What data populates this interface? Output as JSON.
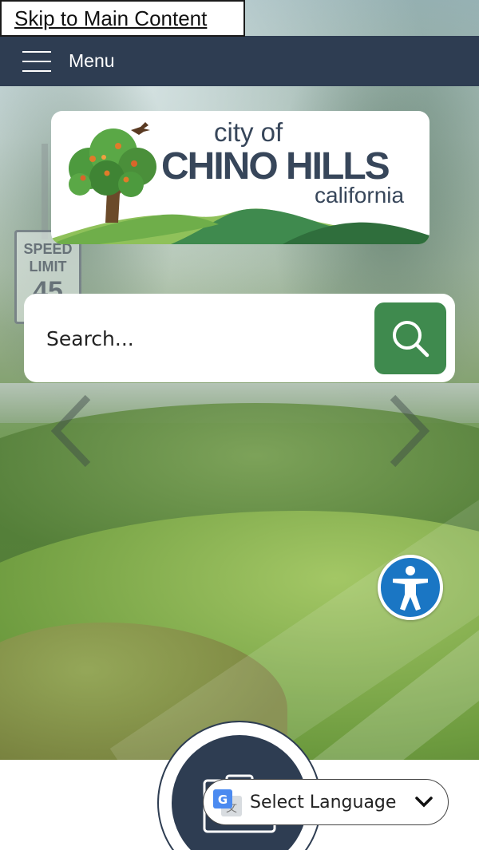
{
  "skip_link": {
    "label": "Skip to Main Content"
  },
  "menu_bar": {
    "label": "Menu",
    "icon": "hamburger-icon",
    "background": "#2e3d52"
  },
  "logo": {
    "line1": "city of",
    "line2": "CHINO HILLS",
    "line3": "california",
    "text_color": "#37465a"
  },
  "search": {
    "placeholder": "Search...",
    "button_icon": "search-icon",
    "button_color": "#3f8a4e"
  },
  "hero": {
    "prev_icon": "chevron-left-icon",
    "next_icon": "chevron-right-icon",
    "sign_line1": "SPEED",
    "sign_line2": "LIMIT",
    "sign_line3": "45"
  },
  "accessibility": {
    "icon": "accessibility-icon",
    "color": "#1a76c4"
  },
  "floating_action": {
    "icon": "clipboard-icon"
  },
  "language": {
    "label": "Select Language",
    "icon": "google-translate-icon",
    "chevron": "chevron-down-icon"
  }
}
